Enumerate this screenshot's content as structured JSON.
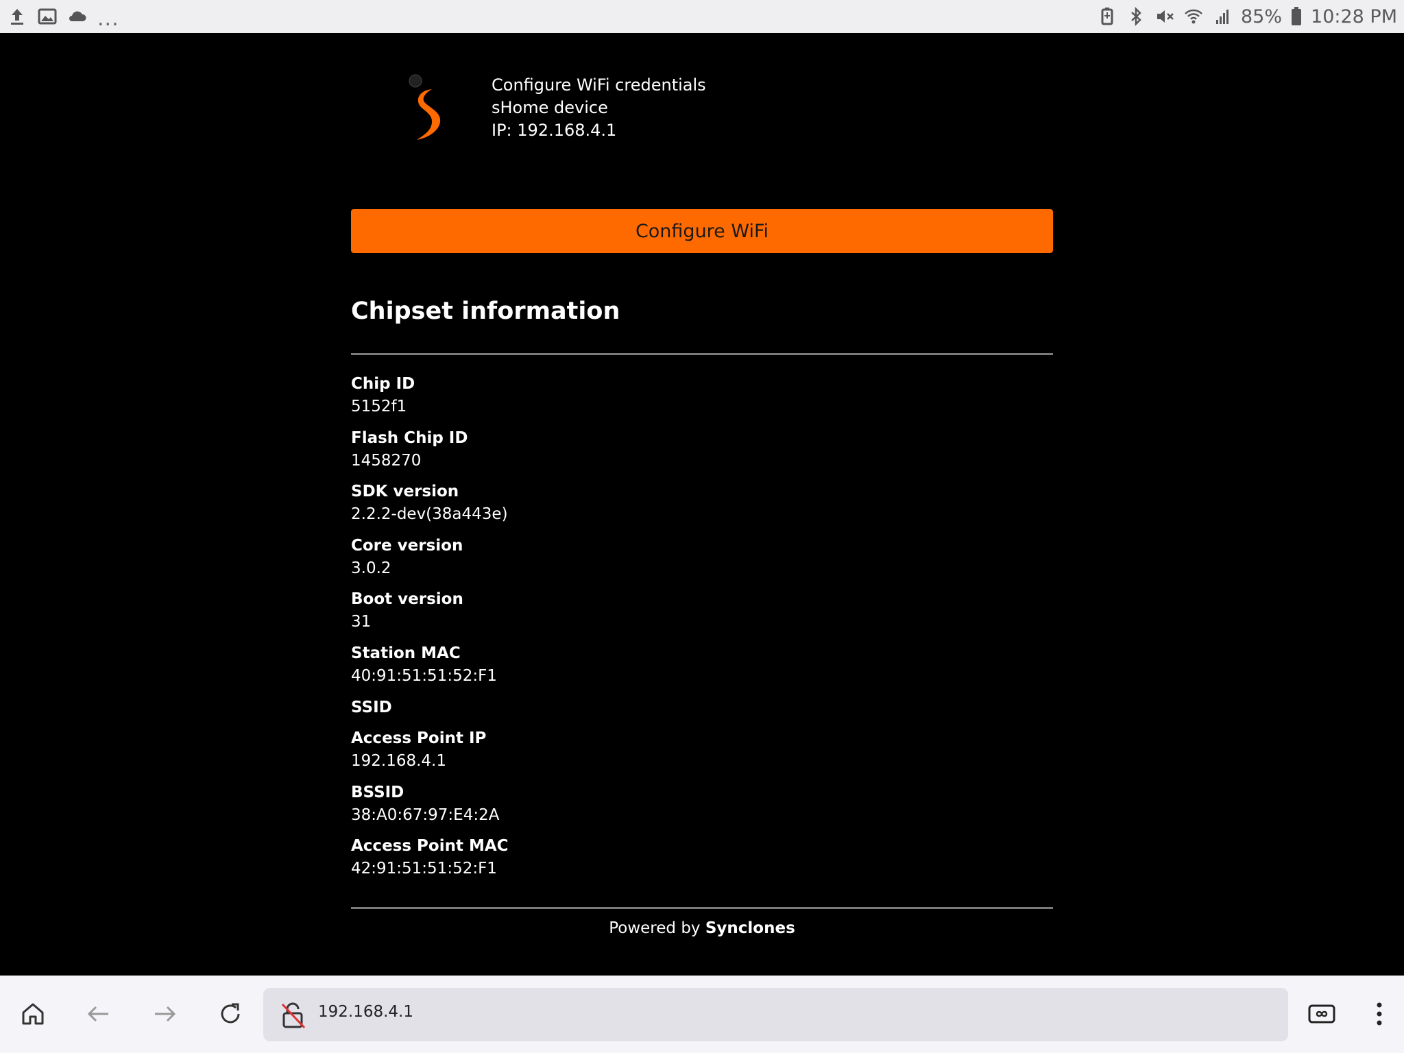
{
  "status_bar": {
    "more": "...",
    "battery_percent": "85%",
    "time": "10:28 PM"
  },
  "header": {
    "title": "Configure WiFi credentials",
    "device": "sHome device",
    "ip": "IP: 192.168.4.1"
  },
  "configure_button": "Configure WiFi",
  "section_title": "Chipset information",
  "info": [
    {
      "label": "Chip ID",
      "value": "5152f1"
    },
    {
      "label": "Flash Chip ID",
      "value": "1458270"
    },
    {
      "label": "SDK version",
      "value": "2.2.2-dev(38a443e)"
    },
    {
      "label": "Core version",
      "value": "3.0.2"
    },
    {
      "label": "Boot version",
      "value": "31"
    },
    {
      "label": "Station MAC",
      "value": "40:91:51:51:52:F1"
    },
    {
      "label": "SSID",
      "value": ""
    },
    {
      "label": "Access Point IP",
      "value": "192.168.4.1"
    },
    {
      "label": "BSSID",
      "value": "38:A0:67:97:E4:2A"
    },
    {
      "label": "Access Point MAC",
      "value": "42:91:51:51:52:F1"
    }
  ],
  "footer": {
    "prefix": "Powered by ",
    "brand": "Synclones"
  },
  "browser": {
    "url": "192.168.4.1"
  },
  "colors": {
    "accent": "#ff6a00",
    "background": "#000000"
  }
}
